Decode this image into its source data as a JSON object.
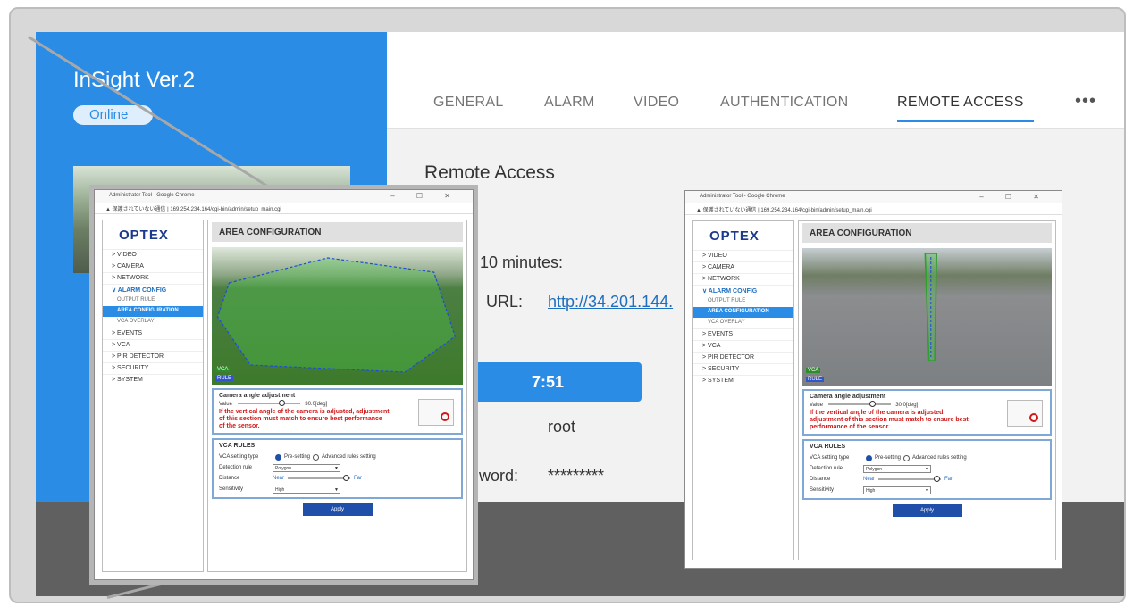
{
  "app": {
    "title": "InSight Ver.2",
    "status": "Online",
    "tabs": [
      "GENERAL",
      "ALARM",
      "VIDEO",
      "AUTHENTICATION",
      "REMOTE ACCESS"
    ],
    "more_icon": "more-horizontal-icon",
    "section_title": "Remote Access",
    "duration_text": "10 minutes:",
    "url_label": "URL:",
    "url_value": "http://34.201.144.",
    "timer": "7:51",
    "username": "root",
    "password_label": "word:",
    "password": "*********"
  },
  "browser": {
    "title": "Administrator Tool - Google Chrome",
    "window_controls": "–  ☐  ✕",
    "address": "▲ 保護されていない通信 | 169.254.234.164/cgi-bin/admin/setup_main.cgi"
  },
  "optex": {
    "logo": "OPTEX",
    "nav": [
      {
        "label": "> VIDEO"
      },
      {
        "label": "> CAMERA"
      },
      {
        "label": "> NETWORK"
      },
      {
        "label": "∨ ALARM CONFIG"
      },
      {
        "label": "OUTPUT RULE"
      },
      {
        "label": "AREA CONFIGURATION"
      },
      {
        "label": "VCA OVERLAY"
      },
      {
        "label": "> EVENTS"
      },
      {
        "label": "> VCA"
      },
      {
        "label": "> PIR DETECTOR"
      },
      {
        "label": "> SECURITY"
      },
      {
        "label": "> SYSTEM"
      }
    ],
    "heading": "AREA CONFIGURATION",
    "vca_badge": "VCA",
    "rule_badge": "RULE",
    "angle": {
      "title": "Camera angle adjustment",
      "value_label": "Value",
      "value_text": "30.0[deg]",
      "warning": "If the vertical angle of the camera is adjusted, adjustment of this section must match to ensure best performance of the sensor."
    },
    "vca_rules": {
      "title": "VCA RULES",
      "setting_type_label": "VCA setting type",
      "preset_label": "Pre-setting",
      "advanced_label": "Advanced rules setting",
      "detection_rule_label": "Detection rule",
      "detection_rule_value": "Polygon",
      "distance_label": "Distance",
      "near": "Near",
      "far": "Far",
      "sensitivity_label": "Sensitivity",
      "sensitivity_value": "High"
    },
    "apply": "Apply"
  },
  "colors": {
    "accent": "#2b8ce6",
    "optex_blue": "#1b3a8c",
    "warning": "#d01818"
  }
}
